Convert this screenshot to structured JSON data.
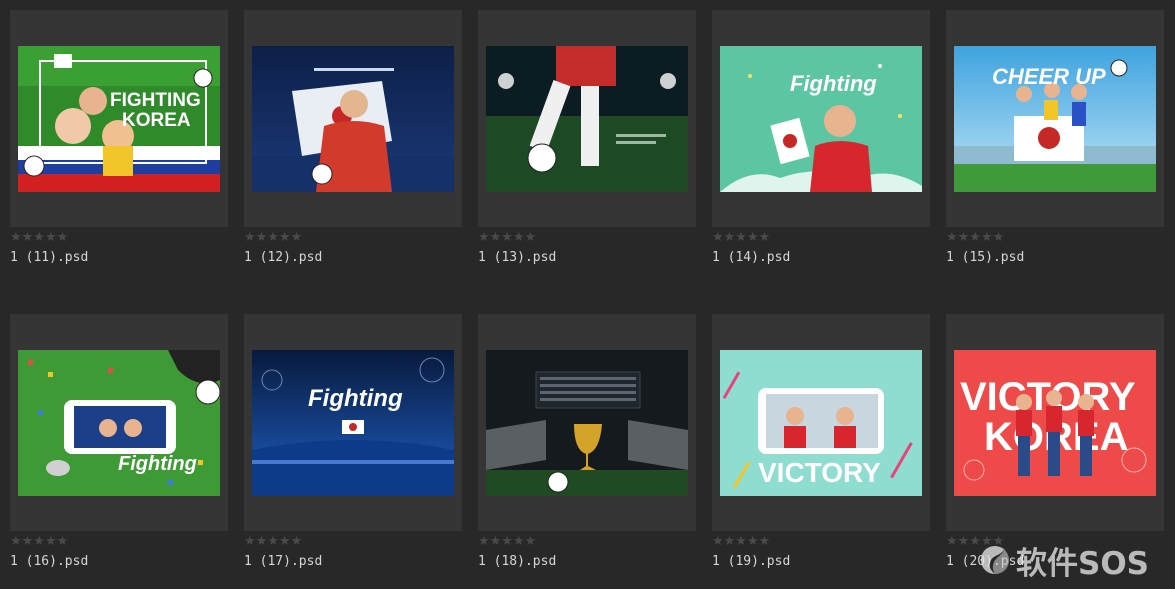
{
  "files": [
    {
      "name": "1 (11).psd",
      "rating": "★★★★★",
      "thumb": {
        "headline": "FIGHTING",
        "headline2": "KOREA",
        "bg": "#2f8a2a"
      }
    },
    {
      "name": "1 (12).psd",
      "rating": "★★★★★",
      "thumb": {
        "bg": "#10254f"
      }
    },
    {
      "name": "1 (13).psd",
      "rating": "★★★★★",
      "thumb": {
        "bg": "#0b1c22"
      }
    },
    {
      "name": "1 (14).psd",
      "rating": "★★★★★",
      "thumb": {
        "script": "Fighting",
        "bg": "#5cc6a3"
      }
    },
    {
      "name": "1 (15).psd",
      "rating": "★★★★★",
      "thumb": {
        "headline": "CHEER UP",
        "bg": "#4fb3e6"
      }
    },
    {
      "name": "1 (16).psd",
      "rating": "★★★★★",
      "thumb": {
        "script": "Fighting",
        "bg": "#3e9a35"
      }
    },
    {
      "name": "1 (17).psd",
      "rating": "★★★★★",
      "thumb": {
        "script": "Fighting",
        "bg": "#0c2a5e"
      }
    },
    {
      "name": "1 (18).psd",
      "rating": "★★★★★",
      "thumb": {
        "bg": "#141a1e"
      }
    },
    {
      "name": "1 (19).psd",
      "rating": "★★★★★",
      "thumb": {
        "headline": "VICTORY",
        "bg": "#8fdcd0"
      }
    },
    {
      "name": "1 (20).psd",
      "rating": "★★★★★",
      "thumb": {
        "headline": "VICTORY",
        "headline2": "KOREA",
        "bg": "#ef4a4a"
      }
    }
  ],
  "watermark": {
    "text": "软件SOS"
  }
}
